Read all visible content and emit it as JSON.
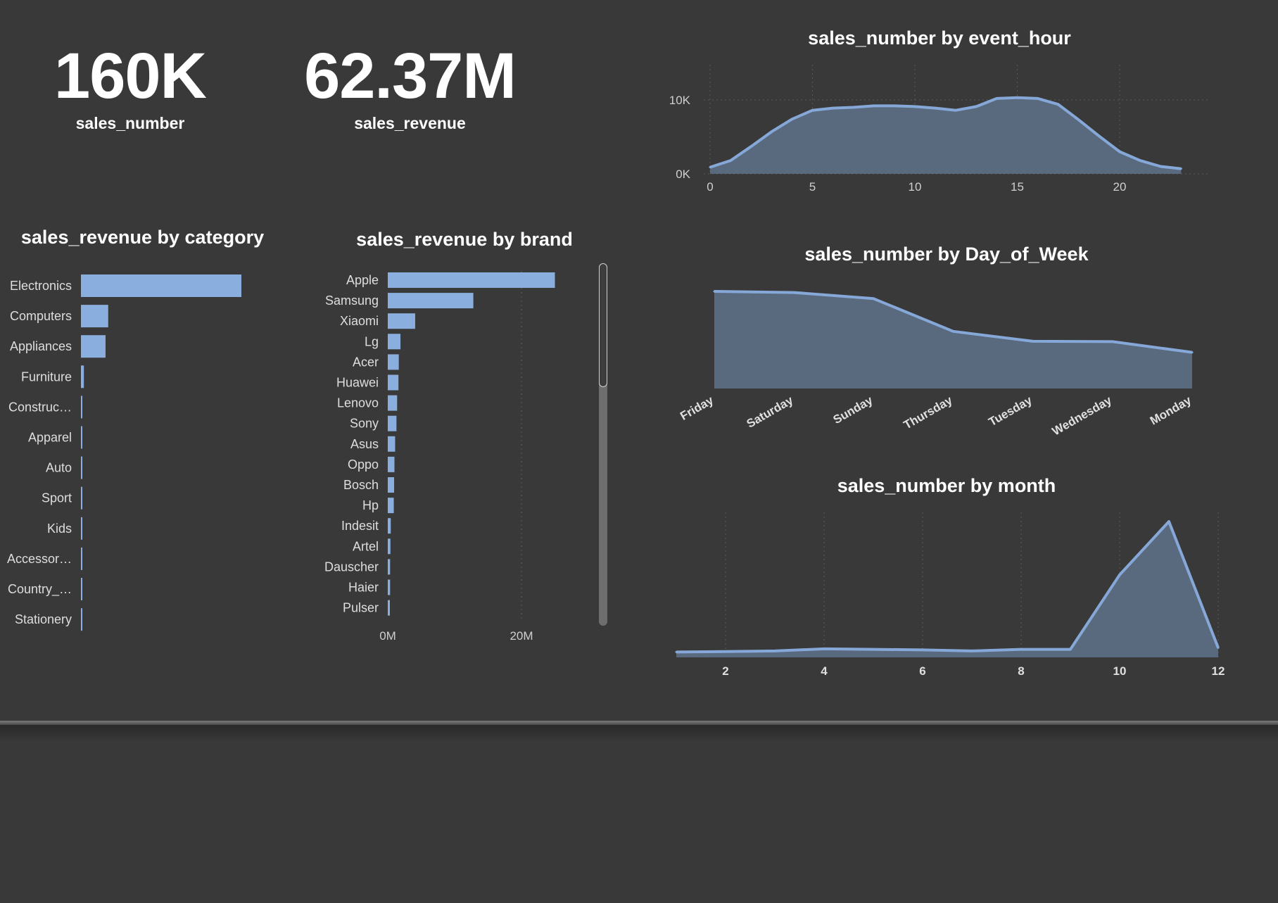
{
  "kpis": [
    {
      "value": "160K",
      "label": "sales_number"
    },
    {
      "value": "62.37M",
      "label": "sales_revenue"
    }
  ],
  "colors": {
    "background": "#393939",
    "bar": "#8aaedd",
    "area_fill": "#5a6a7e",
    "line": "#86a8d8",
    "grid": "#5a5a5a"
  },
  "chart_data": [
    {
      "id": "category",
      "type": "bar",
      "orientation": "horizontal",
      "title": "sales_revenue by category",
      "categories": [
        "Electronics",
        "Computers",
        "Appliances",
        "Furniture",
        "Construc…",
        "Apparel",
        "Auto",
        "Sport",
        "Kids",
        "Accessor…",
        "Country_…",
        "Stationery"
      ],
      "values": [
        30.0,
        5.1,
        4.6,
        0.55,
        0.12,
        0.1,
        0.09,
        0.08,
        0.08,
        0.07,
        0.06,
        0.05
      ],
      "xlim": [
        0,
        30
      ]
    },
    {
      "id": "brand",
      "type": "bar",
      "orientation": "horizontal",
      "title": "sales_revenue by brand",
      "categories": [
        "Apple",
        "Samsung",
        "Xiaomi",
        "Lg",
        "Acer",
        "Huawei",
        "Lenovo",
        "Sony",
        "Asus",
        "Oppo",
        "Bosch",
        "Hp",
        "Indesit",
        "Artel",
        "Dauscher",
        "Haier",
        "Pulser"
      ],
      "values": [
        25.0,
        12.8,
        4.1,
        1.9,
        1.65,
        1.6,
        1.4,
        1.3,
        1.1,
        1.0,
        0.95,
        0.9,
        0.45,
        0.4,
        0.35,
        0.35,
        0.3
      ],
      "xlim": [
        0,
        30
      ],
      "x_ticks": [
        0,
        20
      ],
      "x_tick_labels": [
        "0M",
        "20M"
      ]
    },
    {
      "id": "hour",
      "type": "area",
      "title": "sales_number by event_hour",
      "x": [
        0,
        1,
        2,
        3,
        4,
        5,
        6,
        7,
        8,
        9,
        10,
        11,
        12,
        13,
        14,
        15,
        16,
        17,
        18,
        19,
        20,
        21,
        22,
        23
      ],
      "values": [
        900,
        1800,
        3700,
        5700,
        7400,
        8600,
        8900,
        9000,
        9200,
        9200,
        9100,
        8900,
        8600,
        9100,
        10200,
        10300,
        10200,
        9400,
        7300,
        5100,
        3000,
        1800,
        1000,
        700
      ],
      "xlim": [
        0,
        24
      ],
      "ylim": [
        0,
        10000
      ],
      "x_ticks": [
        0,
        5,
        10,
        15,
        20
      ],
      "y_ticks": [
        0,
        10000
      ],
      "y_tick_labels": [
        "0K",
        "10K"
      ]
    },
    {
      "id": "dow",
      "type": "area",
      "title": "sales_number by Day_of_Week",
      "categories": [
        "Friday",
        "Saturday",
        "Sunday",
        "Thursday",
        "Tuesday",
        "Wednesday",
        "Monday"
      ],
      "values": [
        25500,
        25200,
        23600,
        15000,
        12400,
        12300,
        9500
      ],
      "ylim": [
        0,
        26000
      ]
    },
    {
      "id": "month",
      "type": "area",
      "title": "sales_number by month",
      "x": [
        1,
        2,
        3,
        4,
        5,
        6,
        7,
        8,
        9,
        10,
        11,
        12
      ],
      "values": [
        1000,
        1100,
        1200,
        1600,
        1500,
        1400,
        1200,
        1500,
        1500,
        15500,
        25500,
        1800
      ],
      "xlim": [
        1,
        12
      ],
      "ylim": [
        0,
        25500
      ],
      "x_ticks": [
        2,
        4,
        6,
        8,
        10,
        12
      ]
    }
  ]
}
